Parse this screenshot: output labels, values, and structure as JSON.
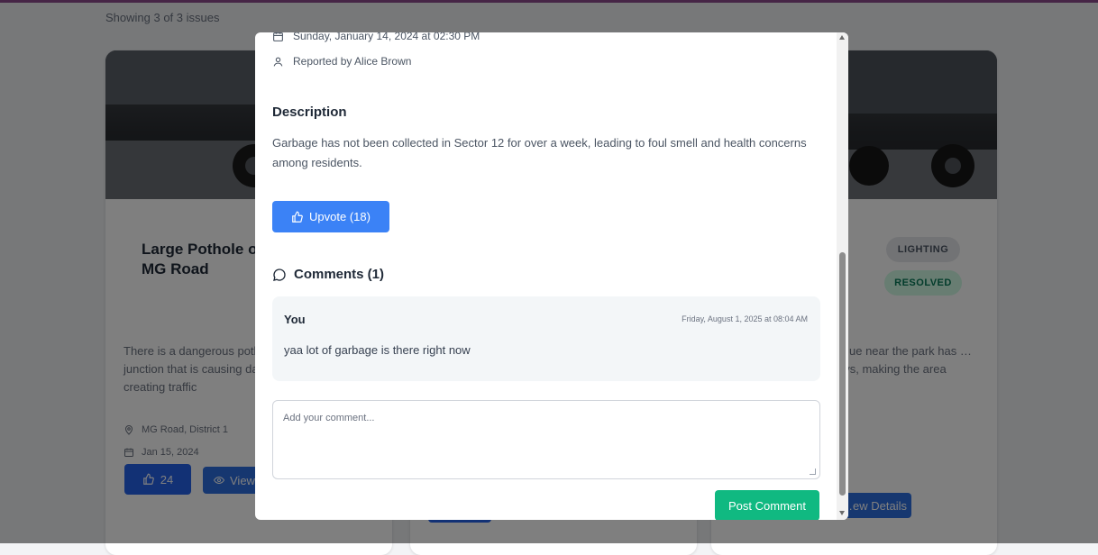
{
  "page": {
    "showing": "Showing 3 of 3 issues"
  },
  "cards": {
    "left": {
      "title": "Large Pothole on MG Road",
      "description": "There is a dangerous pothole at the MG Road junction that is causing damage to vehicles and creating traffic",
      "location": "MG Road, District 1",
      "date": "Jan 15, 2024",
      "upvotes": "24",
      "view_label": "View Details"
    },
    "right": {
      "category_badge": "LIGHTING",
      "status_badge": "RESOLVED",
      "description": "…ue near the park has …ays, making the area",
      "view_label": "…ew Details"
    }
  },
  "modal": {
    "datetime": "Sunday, January 14, 2024 at 02:30 PM",
    "reporter": "Reported by Alice Brown",
    "description_heading": "Description",
    "description_text": "Garbage has not been collected in Sector 12 for over a week, leading to foul smell and health concerns among residents.",
    "upvote_label": "Upvote (18)",
    "comments_heading": "Comments (1)",
    "comments": [
      {
        "author": "You",
        "date": "Friday, August 1, 2025 at 08:04 AM",
        "text": "yaa lot of garbage is there right now"
      }
    ],
    "comment_input": {
      "placeholder": "Add your comment..."
    },
    "post_button": "Post Comment"
  },
  "colors": {
    "primary_blue": "#3b82f6",
    "dark_blue": "#2563eb",
    "green": "#10b981",
    "overlay": "rgba(0,0,0,0.5)"
  }
}
